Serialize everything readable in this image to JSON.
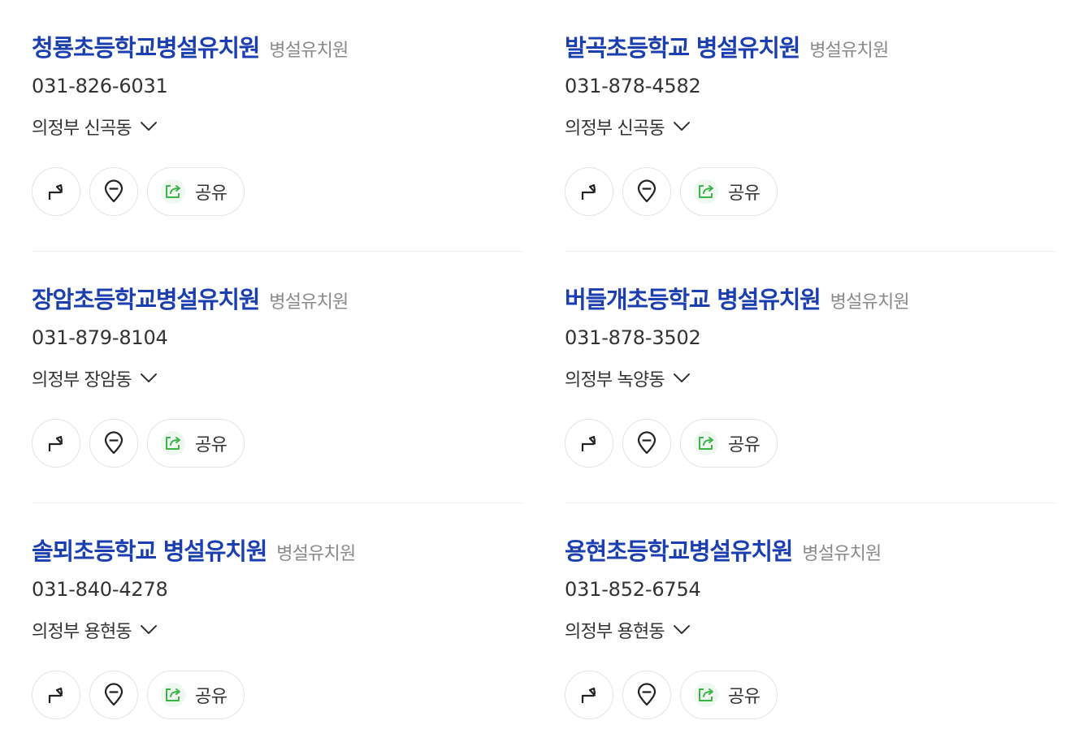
{
  "places": [
    {
      "name": "청룡초등학교병설유치원",
      "category": "병설유치원",
      "phone": "031-826-6031",
      "address": "의정부 신곡동",
      "share_label": "공유"
    },
    {
      "name": "발곡초등학교 병설유치원",
      "category": "병설유치원",
      "phone": "031-878-4582",
      "address": "의정부 신곡동",
      "share_label": "공유"
    },
    {
      "name": "장암초등학교병설유치원",
      "category": "병설유치원",
      "phone": "031-879-8104",
      "address": "의정부 장암동",
      "share_label": "공유"
    },
    {
      "name": "버들개초등학교 병설유치원",
      "category": "병설유치원",
      "phone": "031-878-3502",
      "address": "의정부 녹양동",
      "share_label": "공유"
    },
    {
      "name": "솔뫼초등학교 병설유치원",
      "category": "병설유치원",
      "phone": "031-840-4278",
      "address": "의정부 용현동",
      "share_label": "공유"
    },
    {
      "name": "용현초등학교병설유치원",
      "category": "병설유치원",
      "phone": "031-852-6754",
      "address": "의정부 용현동",
      "share_label": "공유"
    }
  ],
  "icons": {
    "directions": "directions-arrow-icon",
    "location": "map-pin-icon",
    "share": "share-icon",
    "expand": "chevron-down-icon"
  },
  "colors": {
    "title": "#1b3fb0",
    "category": "#8a8a8a",
    "share_accent": "#3cb44a"
  }
}
